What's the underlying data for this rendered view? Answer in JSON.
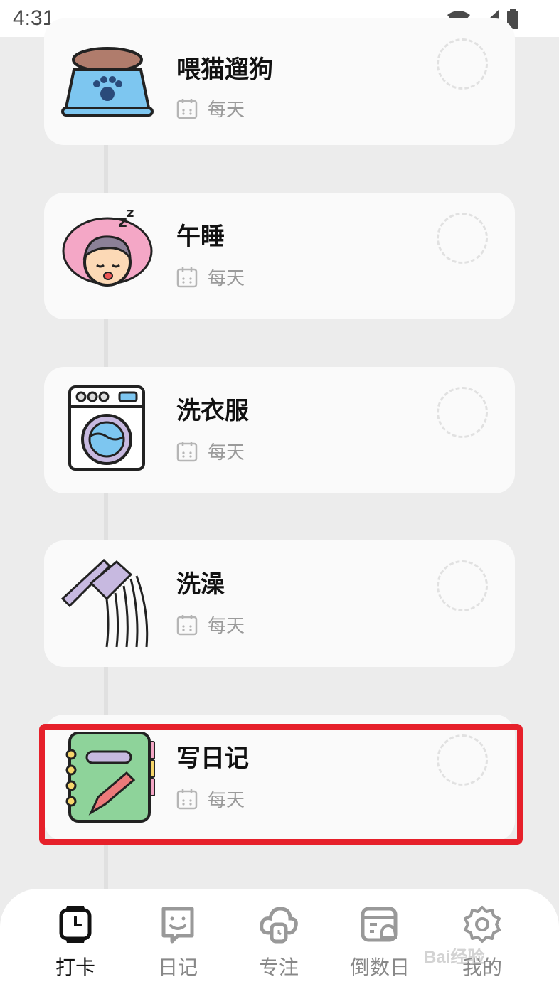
{
  "status_bar": {
    "time": "4:31"
  },
  "tasks": [
    {
      "title": "喂猫遛狗",
      "frequency": "每天",
      "icon": "pet-bowl-icon"
    },
    {
      "title": "午睡",
      "frequency": "每天",
      "icon": "sleeping-person-icon"
    },
    {
      "title": "洗衣服",
      "frequency": "每天",
      "icon": "washing-machine-icon"
    },
    {
      "title": "洗澡",
      "frequency": "每天",
      "icon": "shower-icon"
    },
    {
      "title": "写日记",
      "frequency": "每天",
      "icon": "diary-notebook-icon"
    }
  ],
  "tabbar": {
    "tabs": [
      {
        "label": "打卡",
        "icon": "watch-icon",
        "active": true
      },
      {
        "label": "日记",
        "icon": "smile-note-icon",
        "active": false
      },
      {
        "label": "专注",
        "icon": "focus-cloud-icon",
        "active": false
      },
      {
        "label": "倒数日",
        "icon": "calendar-bell-icon",
        "active": false
      },
      {
        "label": "我的",
        "icon": "gear-icon",
        "active": false
      }
    ]
  },
  "watermark": {
    "text": "Bai经验"
  },
  "colors": {
    "highlight": "#e6202a",
    "background": "#ececec",
    "card": "#fafafa"
  }
}
